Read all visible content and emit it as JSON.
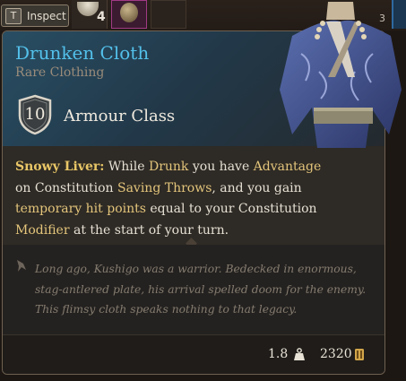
{
  "inventory": {
    "inspect_key": "T",
    "inspect_label": "Inspect",
    "food_count": "4",
    "right_count": "3"
  },
  "item": {
    "name": "Drunken Cloth",
    "rarity": "Rare Clothing",
    "armour_class_value": "10",
    "armour_class_label": "Armour Class",
    "passive": {
      "name": "Snowy Liver:",
      "t1": " While ",
      "k1": "Drunk",
      "t2": " you have ",
      "k2": "Advantage",
      "t3": " on Constitution ",
      "k3": "Saving Throws",
      "t4": ", and you gain ",
      "k4": "temporary hit points",
      "t5": " equal to your Constitution ",
      "k5": "Modifier",
      "t6": " at the start of your turn."
    },
    "lore": "Long ago, Kushigo was a warrior. Bedecked in enormous, stag-antlered plate, his arrival spelled doom for the enemy. This flimsy cloth speaks nothing to that legacy.",
    "weight": "1.8",
    "price": "2320"
  },
  "colors": {
    "name": "#53c0ea",
    "keyword": "#e3c57b",
    "passive": "#e9c767"
  },
  "icons": [
    "weight-icon",
    "gold-coin-icon",
    "lore-quill-icon",
    "shield-icon"
  ]
}
